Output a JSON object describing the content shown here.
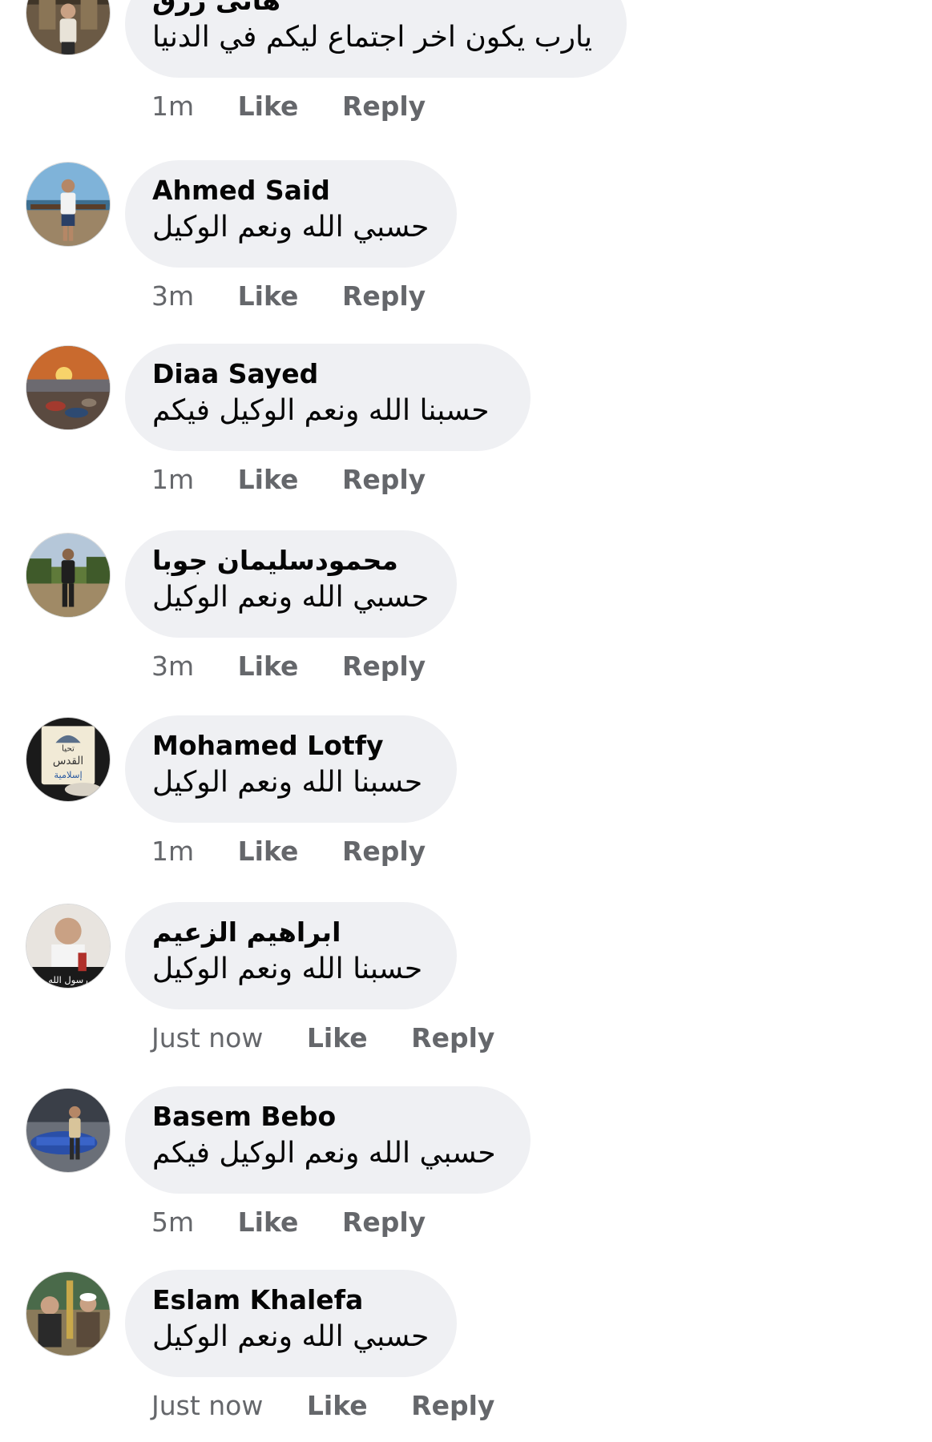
{
  "comments": [
    {
      "author": "هانى رزق",
      "text": "يارب يكون اخر اجتماع ليكم في الدنيا",
      "time": "1m",
      "like": "Like",
      "reply": "Reply"
    },
    {
      "author": "Ahmed Said",
      "text": "حسبي الله ونعم الوكيل",
      "time": "3m",
      "like": "Like",
      "reply": "Reply"
    },
    {
      "author": "Diaa Sayed",
      "text": "حسبنا الله ونعم الوكيل فيكم",
      "time": "1m",
      "like": "Like",
      "reply": "Reply"
    },
    {
      "author": "محمودسليمان جوبا",
      "text": "حسبي الله ونعم الوكيل",
      "time": "3m",
      "like": "Like",
      "reply": "Reply"
    },
    {
      "author": "Mohamed Lotfy",
      "text": "حسبنا الله ونعم الوكيل",
      "time": "1m",
      "like": "Like",
      "reply": "Reply"
    },
    {
      "author": "ابراهيم الزعيم",
      "text": "حسبنا الله ونعم الوكيل",
      "time": "Just now",
      "like": "Like",
      "reply": "Reply"
    },
    {
      "author": "Basem Bebo",
      "text": "حسبي الله ونعم الوكيل فيكم",
      "time": "5m",
      "like": "Like",
      "reply": "Reply"
    },
    {
      "author": "Eslam Khalefa",
      "text": "حسبي الله ونعم الوكيل",
      "time": "Just now",
      "like": "Like",
      "reply": "Reply"
    }
  ],
  "avatar_badges": {
    "mohamed_lotfy": [
      "تحيا",
      "القدس",
      "إسلامية"
    ],
    "ibrahim": "رسول الله"
  },
  "colors": {
    "bubble": "#eff0f3",
    "author_text": "#050505",
    "meta_text": "#65676b"
  }
}
